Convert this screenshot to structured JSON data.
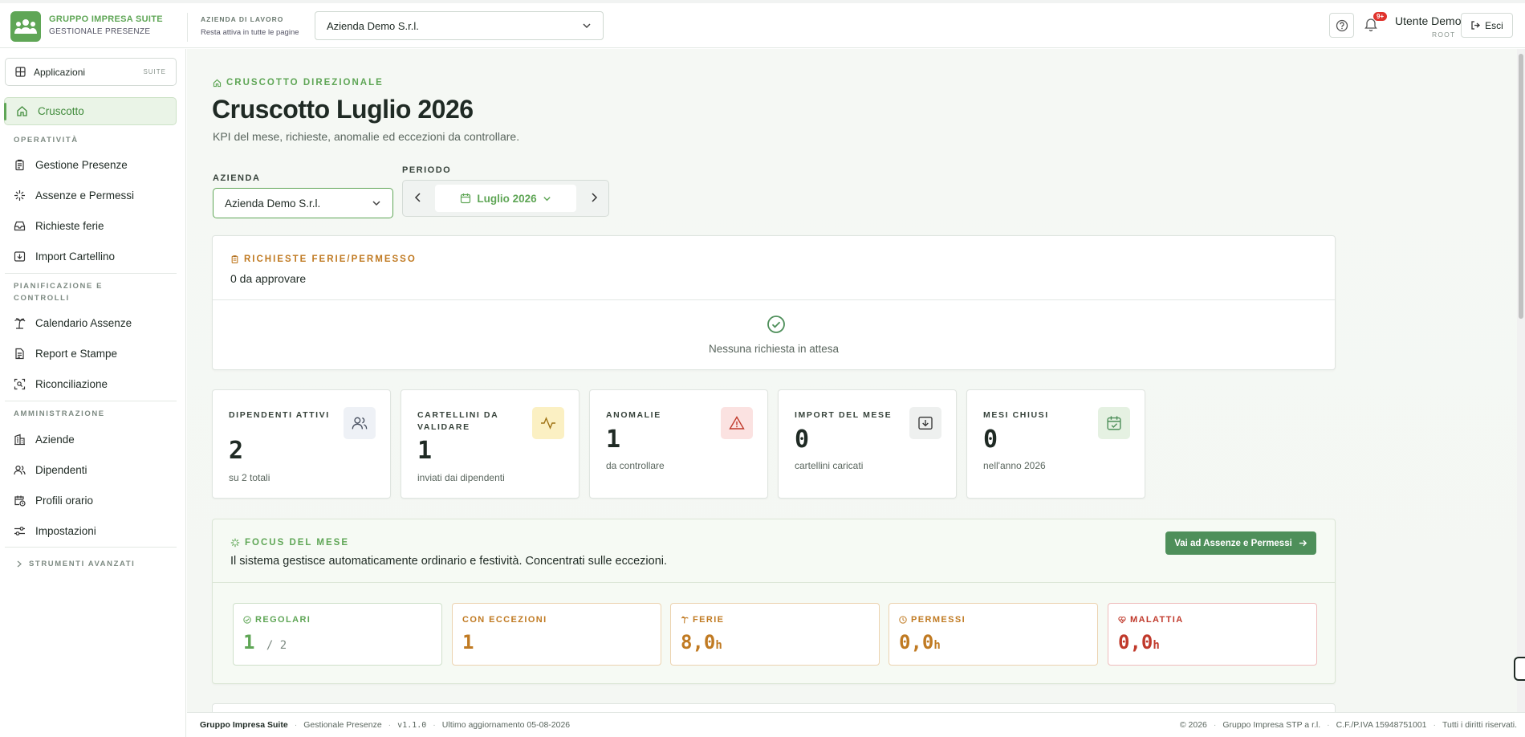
{
  "header": {
    "brand_title": "GRUPPO IMPRESA SUITE",
    "brand_subtitle": "GESTIONALE PRESENZE",
    "company_label": "AZIENDA DI LAVORO",
    "company_hint": "Resta attiva in tutte le pagine",
    "company_value": "Azienda Demo S.r.l.",
    "notifications_badge": "9+",
    "user_name": "Utente Demo",
    "user_role": "ROOT",
    "logout_label": "Esci"
  },
  "sidebar": {
    "apps_label": "Applicazioni",
    "apps_tag": "SUITE",
    "active_item": "Cruscotto",
    "section_operativita": "OPERATIVITÀ",
    "items_operativita": [
      "Gestione Presenze",
      "Assenze e Permessi",
      "Richieste ferie",
      "Import Cartellino"
    ],
    "section_pianificazione": "PIANIFICAZIONE E CONTROLLI",
    "items_pianificazione": [
      "Calendario Assenze",
      "Report e Stampe",
      "Riconciliazione"
    ],
    "section_amministrazione": "AMMINISTRAZIONE",
    "items_amministrazione": [
      "Aziende",
      "Dipendenti",
      "Profili orario",
      "Impostazioni"
    ],
    "advanced_label": "STRUMENTI AVANZATI"
  },
  "main": {
    "eyebrow": "CRUSCOTTO DIREZIONALE",
    "title": "Cruscotto Luglio 2026",
    "subtitle": "KPI del mese, richieste, anomalie ed eccezioni da controllare.",
    "filter_company_label": "AZIENDA",
    "filter_company_value": "Azienda Demo S.r.l.",
    "filter_period_label": "PERIODO",
    "filter_period_value": "Luglio 2026",
    "requests": {
      "title": "RICHIESTE FERIE/PERMESSO",
      "count": "0 da approvare",
      "empty": "Nessuna richiesta in attesa"
    },
    "kpis": [
      {
        "label": "DIPENDENTI ATTIVI",
        "value": "2",
        "sub": "su 2 totali",
        "icon": "users-icon"
      },
      {
        "label": "CARTELLINI DA VALIDARE",
        "value": "1",
        "sub": "inviati dai dipendenti",
        "icon": "activity-icon"
      },
      {
        "label": "ANOMALIE",
        "value": "1",
        "sub": "da controllare",
        "icon": "alert-triangle-icon"
      },
      {
        "label": "IMPORT DEL MESE",
        "value": "0",
        "sub": "cartellini caricati",
        "icon": "import-icon"
      },
      {
        "label": "MESI CHIUSI",
        "value": "0",
        "sub": "nell'anno 2026",
        "icon": "calendar-check-icon"
      }
    ],
    "focus": {
      "title": "FOCUS DEL MESE",
      "text": "Il sistema gestisce automaticamente ordinario e festività. Concentrati sulle eccezioni.",
      "button": "Vai ad Assenze e Permessi",
      "stats": [
        {
          "label": "REGOLARI",
          "value": "1",
          "denominator": "/ 2",
          "color": "#5fa656"
        },
        {
          "label": "CON ECCEZIONI",
          "value": "1",
          "color": "#c07a22"
        },
        {
          "label": "FERIE",
          "value": "8,0",
          "unit": "h",
          "color": "#c07a22"
        },
        {
          "label": "PERMESSI",
          "value": "0,0",
          "unit": "h",
          "color": "#c07a22"
        },
        {
          "label": "MALATTIA",
          "value": "0,0",
          "unit": "h",
          "color": "#c0392b"
        }
      ]
    }
  },
  "footer": {
    "app": "Gruppo Impresa Suite",
    "module": "Gestionale Presenze",
    "version": "v1.1.0",
    "updated": "Ultimo aggiornamento 05-08-2026",
    "copyright": "© 2026",
    "company": "Gruppo Impresa STP a r.l.",
    "vat": "C.F./P.IVA 15948751001",
    "rights": "Tutti i diritti riservati."
  },
  "colors": {
    "accent": "#5fa656",
    "warning": "#c07a22",
    "danger": "#c0392b",
    "button": "#4e8f5a"
  }
}
